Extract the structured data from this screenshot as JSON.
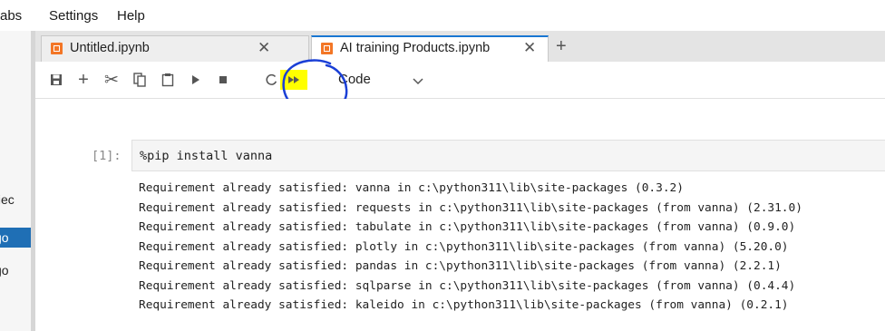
{
  "menubar": {
    "items": [
      "abs",
      "Settings",
      "Help"
    ]
  },
  "sidebar": {
    "items": [
      "fiec",
      "go",
      "go"
    ]
  },
  "tabs": [
    {
      "label": "Untitled.ipynb",
      "close": "✕",
      "active": false
    },
    {
      "label": "AI training Products.ipynb",
      "close": "✕",
      "active": true
    }
  ],
  "tab_add": "+",
  "toolbar": {
    "cell_type": "Code",
    "icons": [
      "save-icon",
      "add-cell-icon",
      "cut-icon",
      "copy-icon",
      "paste-icon",
      "run-icon",
      "stop-icon",
      "restart-icon",
      "fast-forward-icon",
      "chevron-down-icon"
    ],
    "highlight_color": "#ffff00"
  },
  "cell": {
    "prompt": "[1]:",
    "input": "%pip install vanna",
    "output": [
      "Requirement already satisfied: vanna in c:\\python311\\lib\\site-packages (0.3.2)",
      "Requirement already satisfied: requests in c:\\python311\\lib\\site-packages (from vanna) (2.31.0)",
      "Requirement already satisfied: tabulate in c:\\python311\\lib\\site-packages (from vanna) (0.9.0)",
      "Requirement already satisfied: plotly in c:\\python311\\lib\\site-packages (from vanna) (5.20.0)",
      "Requirement already satisfied: pandas in c:\\python311\\lib\\site-packages (from vanna) (2.2.1)",
      "Requirement already satisfied: sqlparse in c:\\python311\\lib\\site-packages (from vanna) (0.4.4)",
      "Requirement already satisfied: kaleido in c:\\python311\\lib\\site-packages (from vanna) (0.2.1)"
    ]
  },
  "colors": {
    "accent": "#1976d2",
    "notebook_icon": "#f37626",
    "annotation": "#1a3fd6",
    "selected_sidebar": "#1f6fb5"
  }
}
